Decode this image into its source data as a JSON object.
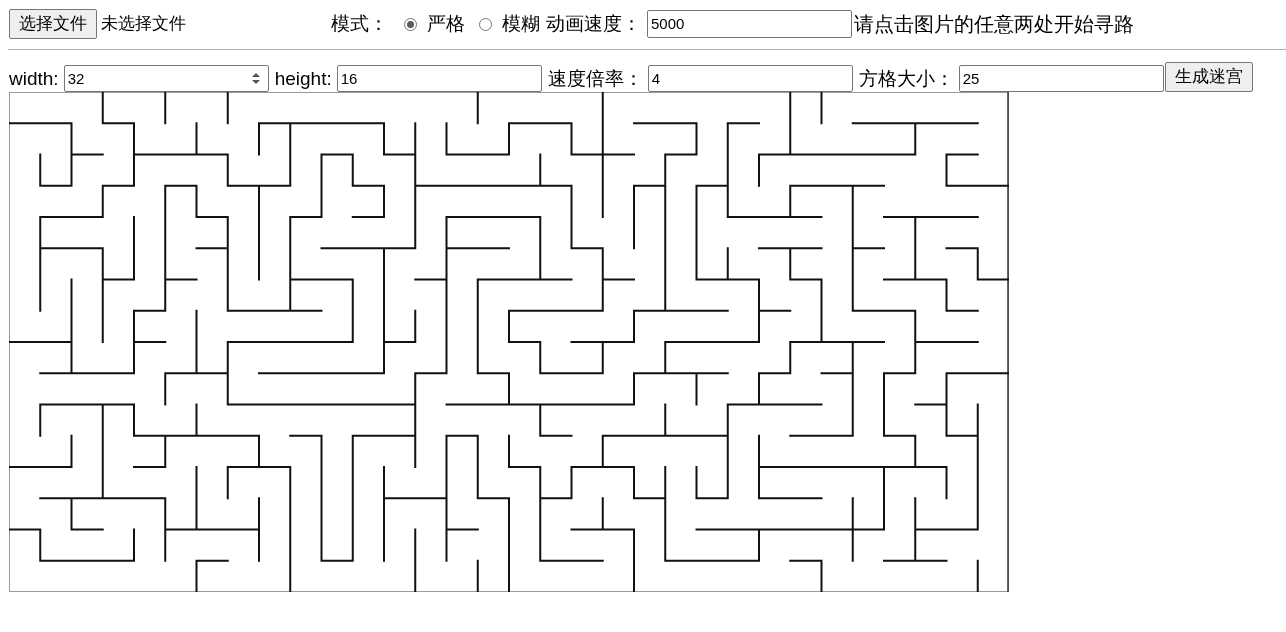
{
  "file_picker": {
    "button": "选择文件",
    "status": "未选择文件"
  },
  "mode": {
    "label": "模式：",
    "options": [
      {
        "label": "严格",
        "selected": true
      },
      {
        "label": "模糊",
        "selected": false
      }
    ]
  },
  "animation_speed": {
    "label": "动画速度：",
    "value": "5000"
  },
  "hint": "请点击图片的任意两处开始寻路",
  "maze_settings": {
    "fields": [
      {
        "label": "width:",
        "value": "32",
        "kind": "number"
      },
      {
        "label": "height:",
        "value": "16",
        "kind": "text"
      },
      {
        "label": "速度倍率：",
        "value": "4",
        "kind": "text"
      },
      {
        "label": "方格大小：",
        "value": "25",
        "kind": "text"
      }
    ],
    "button": "生成迷宫"
  }
}
